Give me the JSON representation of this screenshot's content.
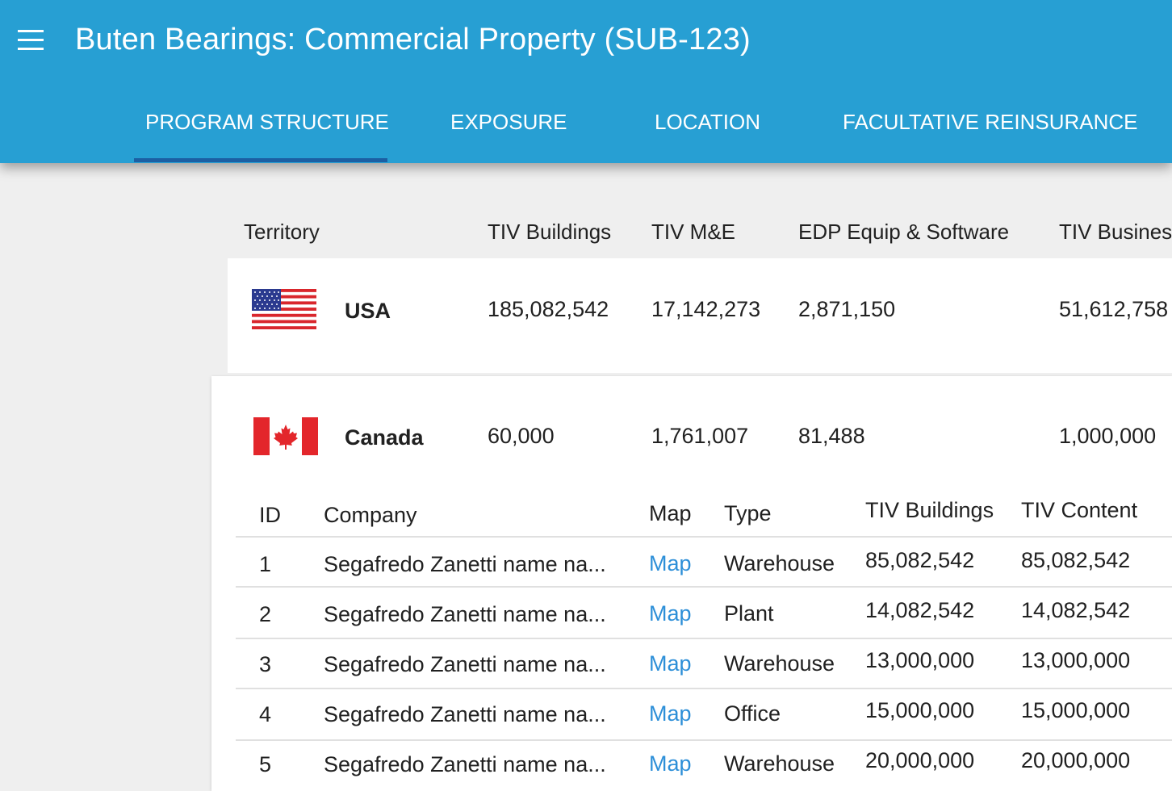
{
  "appbar": {
    "title": "Buten Bearings: Commercial Property (SUB-123)",
    "background": "#279fd3",
    "tabs": [
      {
        "label": "PROGRAM STRUCTURE",
        "active": true
      },
      {
        "label": "EXPOSURE",
        "active": false
      },
      {
        "label": "LOCATION",
        "active": false
      },
      {
        "label": "FACULTATIVE REINSURANCE",
        "active": false
      }
    ]
  },
  "territory_table": {
    "headers": [
      "Territory",
      "TIV Buildings",
      "TIV M&E",
      "EDP Equip & Software",
      "TIV Busines"
    ],
    "rows": [
      {
        "flag": "usa-flag-icon",
        "territory": "USA",
        "tiv_buildings": "185,082,542",
        "tiv_me": "17,142,273",
        "edp": "2,871,150",
        "tiv_business": "51,612,758"
      },
      {
        "flag": "canada-flag-icon",
        "territory": "Canada",
        "tiv_buildings": "60,000",
        "tiv_me": "1,761,007",
        "edp": "81,488",
        "tiv_business": "1,000,000"
      }
    ]
  },
  "locations_table": {
    "headers": [
      "ID",
      "Company",
      "Map",
      "Type",
      "TIV Buildings",
      "TIV Content"
    ],
    "rows": [
      {
        "id": "1",
        "company": "Segafredo Zanetti name na...",
        "map": "Map",
        "type": "Warehouse",
        "tiv_buildings": "85,082,542",
        "tiv_content": "85,082,542"
      },
      {
        "id": "2",
        "company": "Segafredo Zanetti name na...",
        "map": "Map",
        "type": "Plant",
        "tiv_buildings": "14,082,542",
        "tiv_content": "14,082,542"
      },
      {
        "id": "3",
        "company": "Segafredo Zanetti name na...",
        "map": "Map",
        "type": "Warehouse",
        "tiv_buildings": "13,000,000",
        "tiv_content": "13,000,000"
      },
      {
        "id": "4",
        "company": "Segafredo Zanetti name na...",
        "map": "Map",
        "type": "Office",
        "tiv_buildings": "15,000,000",
        "tiv_content": "15,000,000"
      },
      {
        "id": "5",
        "company": "Segafredo Zanetti name na...",
        "map": "Map",
        "type": "Warehouse",
        "tiv_buildings": "20,000,000",
        "tiv_content": "20,000,000"
      }
    ]
  }
}
